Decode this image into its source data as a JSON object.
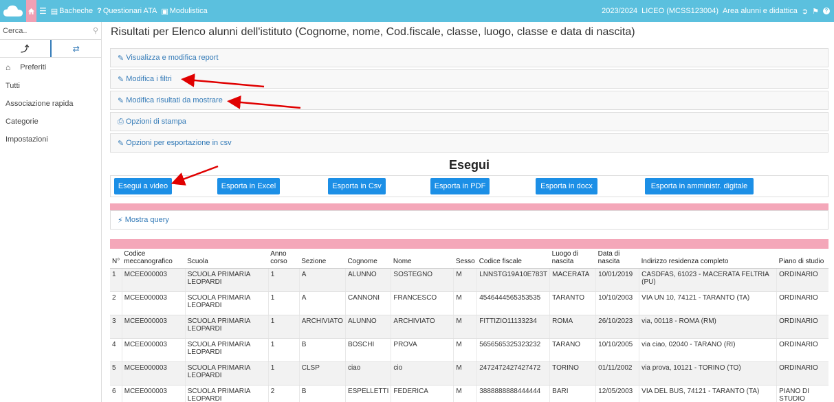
{
  "topbar": {
    "nav": [
      {
        "label": "Bacheche",
        "icon": "board-icon"
      },
      {
        "label": "Questionari ATA",
        "icon": "question-icon"
      },
      {
        "label": "Modulistica",
        "icon": "briefcase-icon"
      }
    ],
    "year": "2023/2024",
    "school": "LICEO (MCSS123004)",
    "area": "Area alunni e didattica"
  },
  "sidebar": {
    "search_placeholder": "Cerca..",
    "items": [
      "Preferiti",
      "Tutti",
      "Associazione rapida",
      "Categorie",
      "Impostazioni"
    ]
  },
  "main": {
    "title": "Risultati per Elenco alunni dell'istituto (Cognome, nome, Cod.fiscale, classe, luogo, classe e data di nascita)",
    "panels": [
      "Visualizza e modifica report",
      "Modifica i filtri",
      "Modifica risultati da mostrare",
      "Opzioni di stampa",
      "Opzioni per esportazione in csv"
    ],
    "esegui": "Esegui",
    "buttons": [
      "Esegui a video",
      "Esporta in Excel",
      "Esporta in Csv",
      "Esporta in PDF",
      "Esporta in docx",
      "Esporta in amministr. digitale"
    ],
    "query": "Mostra query"
  },
  "table": {
    "headers": [
      "N°",
      "Codice meccanografico",
      "Scuola",
      "Anno corso",
      "Sezione",
      "Cognome",
      "Nome",
      "Sesso",
      "Codice fiscale",
      "Luogo di nascita",
      "Data di nascita",
      "Indirizzo residenza completo",
      "Piano di studio"
    ],
    "rows": [
      [
        "1",
        "MCEE000003",
        "SCUOLA PRIMARIA LEOPARDI",
        "1",
        "A",
        "ALUNNO",
        "SOSTEGNO",
        "M",
        "LNNSTG19A10E783T",
        "MACERATA",
        "10/01/2019",
        "CASDFAS, 61023 - MACERATA FELTRIA (PU)",
        "ORDINARIO"
      ],
      [
        "2",
        "MCEE000003",
        "SCUOLA PRIMARIA LEOPARDI",
        "1",
        "A",
        "CANNONI",
        "FRANCESCO",
        "M",
        "4546444565353535",
        "TARANTO",
        "10/10/2003",
        "VIA UN 10, 74121 - TARANTO (TA)",
        "ORDINARIO"
      ],
      [
        "3",
        "MCEE000003",
        "SCUOLA PRIMARIA LEOPARDI",
        "1",
        "ARCHIVIATO",
        "ALUNNO",
        "ARCHIVIATO",
        "M",
        "FITTIZIO11133234",
        "ROMA",
        "26/10/2023",
        "via, 00118 - ROMA (RM)",
        "ORDINARIO"
      ],
      [
        "4",
        "MCEE000003",
        "SCUOLA PRIMARIA LEOPARDI",
        "1",
        "B",
        "BOSCHI",
        "PROVA",
        "M",
        "5656565325323232",
        "TARANO",
        "10/10/2005",
        "via ciao, 02040 - TARANO (RI)",
        "ORDINARIO"
      ],
      [
        "5",
        "MCEE000003",
        "SCUOLA PRIMARIA LEOPARDI",
        "1",
        "CLSP",
        "ciao",
        "cio",
        "M",
        "2472472427427472",
        "TORINO",
        "01/11/2002",
        "via prova, 10121 - TORINO (TO)",
        "ORDINARIO"
      ],
      [
        "6",
        "MCEE000003",
        "SCUOLA PRIMARIA LEOPARDI",
        "2",
        "B",
        "ESPELLETTI",
        "FEDERICA",
        "M",
        "3888888888444444",
        "BARI",
        "12/05/2003",
        "VIA DEL BUS, 74121 - TARANTO (TA)",
        "PIANO DI STUDIO FITTIZIO"
      ]
    ]
  },
  "colors": {
    "topbar": "#5bc0de",
    "accent": "#337ab7",
    "button": "#1c8fe6",
    "pink": "#f4a7b9",
    "arrow": "#e00000"
  }
}
